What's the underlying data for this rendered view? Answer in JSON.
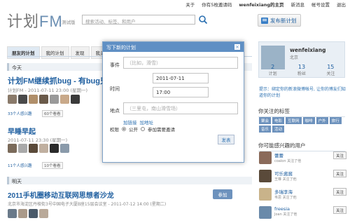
{
  "top_links": [
    "关于",
    "你有5枚邀请码",
    "wenfeixiang的主页",
    "新消息",
    "帐号设置",
    "退出"
  ],
  "header": {
    "logo_main": "计划",
    "logo_fm": "FM",
    "beta": "测试版",
    "search_placeholder": "搜索活动、标签、和用户",
    "publish_label": "发布新计划"
  },
  "tabs": [
    "朋友的计划",
    "我的计划",
    "发现",
    "我关注"
  ],
  "sections": {
    "today": "今天",
    "tomorrow": "明天"
  },
  "posts": [
    {
      "title": "计划FM继续抓bug - 有bug只",
      "meta": "计划FM - 2011-07-11 23:00 (星期一)",
      "interested": "33个人感兴趣",
      "want": "60个看看",
      "accent": "#1f5fa0"
    },
    {
      "title": "早睡早起",
      "meta": "2011-07-11 23:30 (星期一)",
      "interested": "11个人感兴趣",
      "want": "10个看看"
    },
    {
      "title": "2011手机圈移动互联网思想者沙龙",
      "meta": "北京市海淀区丹棱街3号中国电子大厦B座15层会议室 - 2011-07-12 14:00 (星期二)",
      "join_label": "参加"
    }
  ],
  "dialog": {
    "title": "写下新的计划",
    "close": "×",
    "event_label": "事件",
    "event_placeholder": "（比如，滑雪）",
    "time_label": "时间",
    "date_value": "2011-07-11",
    "time_value": "17:00",
    "place_label": "地点",
    "place_placeholder": "（三里屯，南山滑雪场）",
    "add_link": "加链接",
    "add_addr": "加地址",
    "perm_label": "权限",
    "public": "公开",
    "invite": "参加需要邀请",
    "send": "发表"
  },
  "profile": {
    "name": "wenfeixiang",
    "city": "北京",
    "stats": [
      {
        "n": "2",
        "l": "计划"
      },
      {
        "n": "13",
        "l": "粉丝"
      },
      {
        "n": "15",
        "l": "关注"
      }
    ]
  },
  "tip": "提示：绑定你的新浪微博帐号, 让你的博友们知道你的计划",
  "tags_head": "你关注的标签",
  "tags": [
    "聚会",
    "电影",
    "互联网",
    "咖啡",
    "户外",
    "旅行",
    "音乐",
    "活动"
  ],
  "recommend_head": "你可能感兴趣的用户",
  "recommend": [
    {
      "name": "蕾蕾",
      "sub": "coalon 关注了他",
      "follow": "关注"
    },
    {
      "name": "可乐酱酱",
      "sub": "王琳 关注了他",
      "follow": "关注"
    },
    {
      "name": "多瑞李海",
      "sub": "韦思 关注了他",
      "follow": "关注"
    },
    {
      "name": "freesia",
      "sub": "Joan 关注了他",
      "follow": "关注"
    }
  ]
}
